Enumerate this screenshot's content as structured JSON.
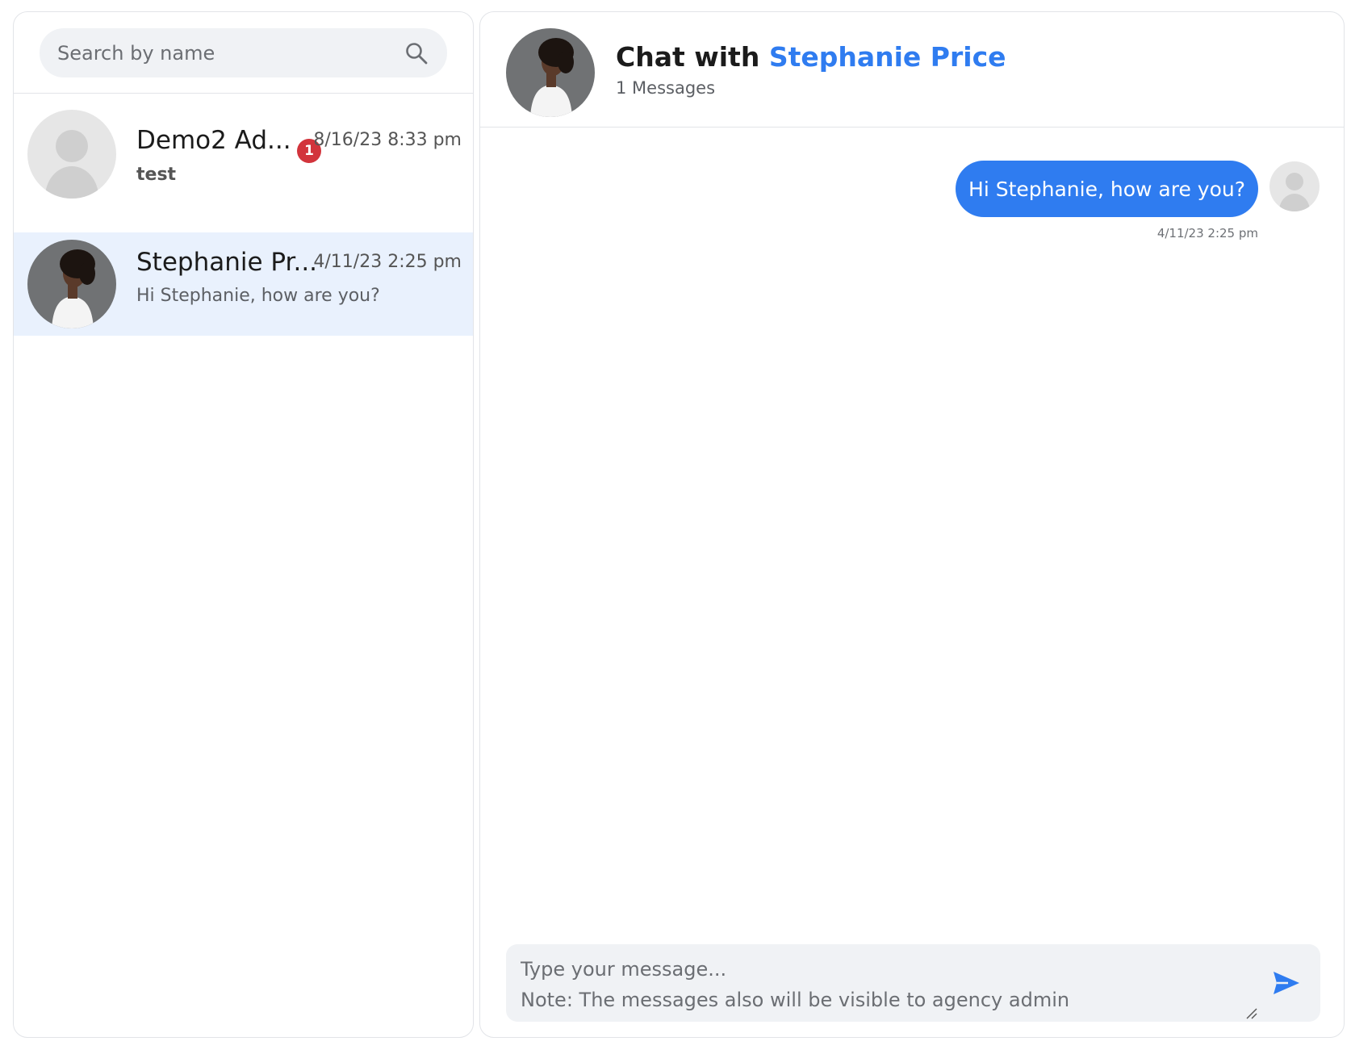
{
  "sidebar": {
    "search": {
      "placeholder": "Search by name",
      "icon": "search-icon"
    },
    "conversations": [
      {
        "name": "Demo2 Ad...",
        "time": "8/16/23 8:33 pm",
        "preview": "test",
        "unread": "1",
        "avatar": "default-avatar",
        "selected": false
      },
      {
        "name": "Stephanie Pr...",
        "time": "4/11/23 2:25 pm",
        "preview": "Hi Stephanie, how are you?",
        "avatar": "photo-avatar",
        "selected": true
      }
    ]
  },
  "chat": {
    "title_prefix": "Chat with",
    "contact_name": "Stephanie Price",
    "message_count": "1 Messages",
    "messages": [
      {
        "text": "Hi Stephanie, how are you?",
        "time": "4/11/23 2:25 pm",
        "outgoing": true
      }
    ],
    "composer": {
      "placeholder": "Type your message...\nNote: The messages also will be visible to agency admin",
      "send_icon": "send-icon"
    }
  },
  "colors": {
    "accent": "#2f7cf0",
    "badge": "#d2343c",
    "selected_row": "#e9f1fd",
    "input_bg": "#f0f2f5"
  }
}
